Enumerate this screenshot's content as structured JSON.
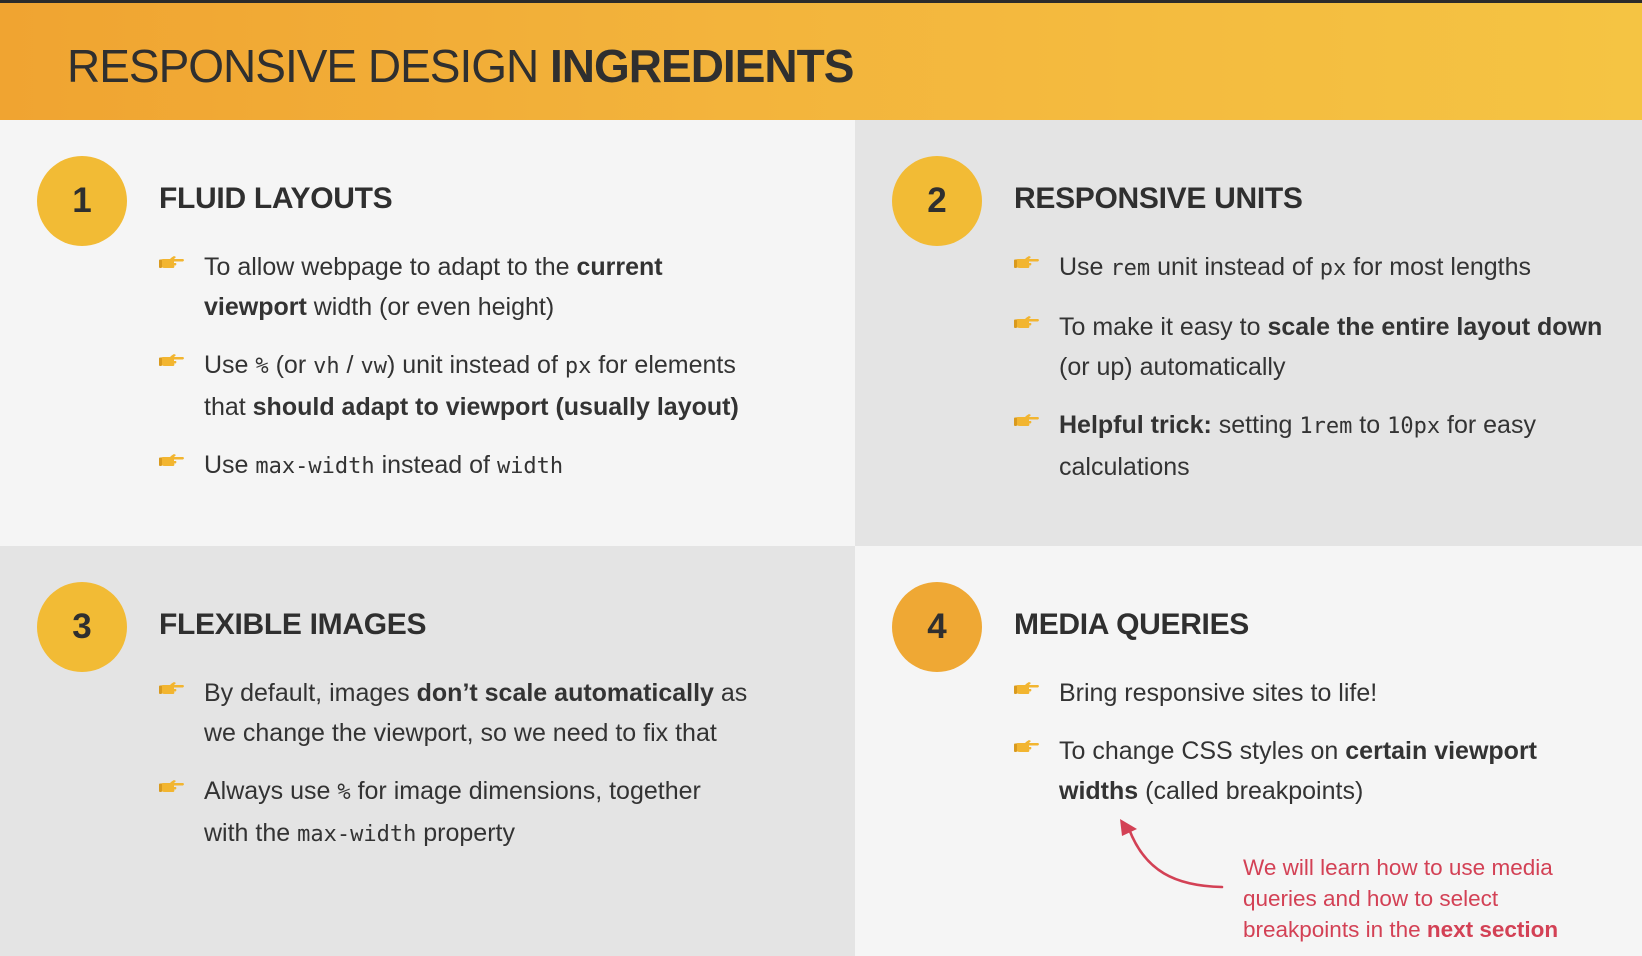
{
  "header": {
    "title_regular": "RESPONSIVE DESIGN ",
    "title_bold": "INGREDIENTS"
  },
  "sections": [
    {
      "number": "1",
      "title": "FLUID LAYOUTS",
      "bullets": [
        [
          {
            "t": "To allow webpage to adapt to the "
          },
          {
            "t": "current",
            "b": true
          },
          {
            "br": true
          },
          {
            "t": "viewport",
            "b": true
          },
          {
            "t": " width (or even height)"
          }
        ],
        [
          {
            "t": "Use "
          },
          {
            "t": "%",
            "c": true
          },
          {
            "t": " (or "
          },
          {
            "t": "vh",
            "c": true
          },
          {
            "t": " / "
          },
          {
            "t": "vw",
            "c": true
          },
          {
            "t": ") unit instead of "
          },
          {
            "t": "px",
            "c": true
          },
          {
            "t": " for elements"
          },
          {
            "br": true
          },
          {
            "t": "that "
          },
          {
            "t": "should adapt to viewport (usually layout)",
            "b": true
          }
        ],
        [
          {
            "t": "Use "
          },
          {
            "t": "max-width",
            "c": true
          },
          {
            "t": " instead of "
          },
          {
            "t": "width",
            "c": true
          }
        ]
      ]
    },
    {
      "number": "2",
      "title": "RESPONSIVE UNITS",
      "bullets": [
        [
          {
            "t": "Use "
          },
          {
            "t": "rem",
            "c": true
          },
          {
            "t": " unit instead of "
          },
          {
            "t": "px",
            "c": true
          },
          {
            "t": " for most lengths"
          }
        ],
        [
          {
            "t": "To make it easy to "
          },
          {
            "t": "scale the entire layout down",
            "b": true
          },
          {
            "br": true
          },
          {
            "t": "(or up) automatically"
          }
        ],
        [
          {
            "t": "Helpful trick:",
            "b": true
          },
          {
            "t": " setting "
          },
          {
            "t": "1rem",
            "c": true
          },
          {
            "t": " to "
          },
          {
            "t": "10px",
            "c": true
          },
          {
            "t": " for easy"
          },
          {
            "br": true
          },
          {
            "t": "calculations"
          }
        ]
      ]
    },
    {
      "number": "3",
      "title": "FLEXIBLE IMAGES",
      "bullets": [
        [
          {
            "t": "By default, images "
          },
          {
            "t": "don’t scale automatically",
            "b": true
          },
          {
            "t": " as"
          },
          {
            "br": true
          },
          {
            "t": "we change the viewport, so we need to fix that"
          }
        ],
        [
          {
            "t": "Always use "
          },
          {
            "t": "%",
            "c": true
          },
          {
            "t": " for image dimensions, together"
          },
          {
            "br": true
          },
          {
            "t": "with the "
          },
          {
            "t": "max-width",
            "c": true
          },
          {
            "t": " property"
          }
        ]
      ]
    },
    {
      "number": "4",
      "title": "MEDIA QUERIES",
      "bullets": [
        [
          {
            "t": "Bring responsive sites to life!"
          }
        ],
        [
          {
            "t": "To change CSS styles on "
          },
          {
            "t": "certain viewport",
            "b": true
          },
          {
            "br": true
          },
          {
            "t": "widths",
            "b": true
          },
          {
            "t": " (called breakpoints)"
          }
        ]
      ]
    }
  ],
  "note": {
    "line1": "We will learn how to use media",
    "line2": "queries and how to select",
    "line3_regular": "breakpoints in the ",
    "line3_bold": "next section"
  },
  "colors": {
    "accent_yellow": "#f2bb35",
    "accent_orange": "#efa834",
    "note_red": "#d34155",
    "hand": "#f2b530"
  },
  "icons": {
    "bullet": "pointing-hand-icon",
    "annotation": "curved-arrow-icon"
  }
}
